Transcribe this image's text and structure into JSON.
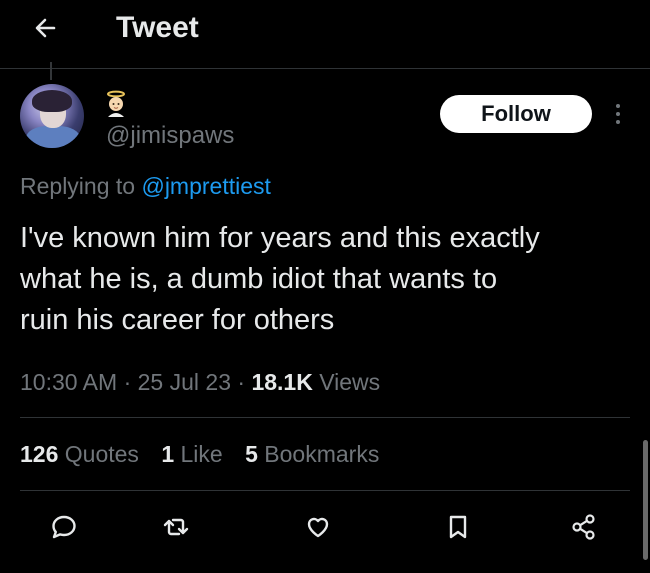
{
  "header": {
    "title": "Tweet",
    "back_icon": "arrow-left-icon"
  },
  "author": {
    "handle": "@jimispaws",
    "badge_emoji": "angel-baby-emoji"
  },
  "follow_label": "Follow",
  "reply": {
    "prefix": "Replying to ",
    "to": "@jmprettiest"
  },
  "tweet": {
    "line1": "I've known him for years and this exactly",
    "line2": "what he is, a dumb idiot that wants to",
    "line3": "ruin his career for others"
  },
  "meta": {
    "time": "10:30 AM",
    "sep": " · ",
    "date": "25 Jul 23",
    "views_count": "18.1K",
    "views_label": " Views"
  },
  "stats": {
    "quotes_count": "126",
    "quotes_label": "Quotes",
    "likes_count": "1",
    "likes_label": "Like",
    "bookmarks_count": "5",
    "bookmarks_label": "Bookmarks"
  },
  "colors": {
    "background": "#000000",
    "text": "#e7e9ea",
    "muted": "#71767b",
    "link": "#1d9bf0",
    "divider": "#2f3336"
  }
}
